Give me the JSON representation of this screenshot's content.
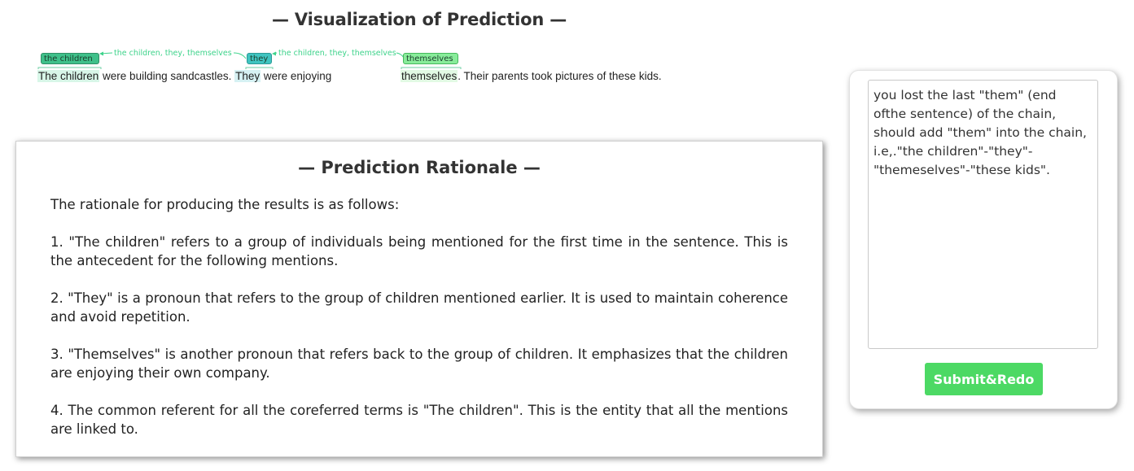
{
  "visualization": {
    "title": "— Visualization of Prediction —",
    "tags": {
      "children": "the children",
      "they": "they",
      "themselves": "themselves"
    },
    "chain_labels": {
      "first": "the children, they, themselves",
      "second": "the children, they, themselves"
    },
    "sentence": {
      "mention1": "The children",
      "text1": " were building sandcastles. ",
      "mention2": "They",
      "text2": " were enjoying",
      "mention3": "themselves",
      "text3": ". Their parents took pictures of these kids."
    },
    "colors": {
      "tag_children": "#3fc08a",
      "tag_they": "#40c4c0",
      "tag_themselves": "#88ec9a",
      "chain_line": "#3ed38b"
    }
  },
  "rationale": {
    "title": "— Prediction Rationale —",
    "paragraphs": [
      "The rationale for producing the results is as follows:",
      "1. \"The children\" refers to a group of individuals being mentioned for the first time in the sentence. This is the antecedent for the following mentions.",
      "2. \"They\" is a pronoun that refers to the group of children mentioned earlier. It is used to maintain coherence and avoid repetition.",
      "3. \"Themselves\" is another pronoun that refers back to the group of children. It emphasizes that the children are enjoying their own company.",
      "4. The common referent for all the coreferred terms is \"The children\". This is the entity that all the mentions are linked to."
    ]
  },
  "feedback": {
    "value": "you lost the last \"them\" (end ofthe sentence) of the chain, should add \"them\" into the chain, i.e,.\"the children\"-\"they\"-\"themeselves\"-\"these kids\".",
    "submit_label": "Submit&Redo",
    "button_color": "#4cd964"
  }
}
